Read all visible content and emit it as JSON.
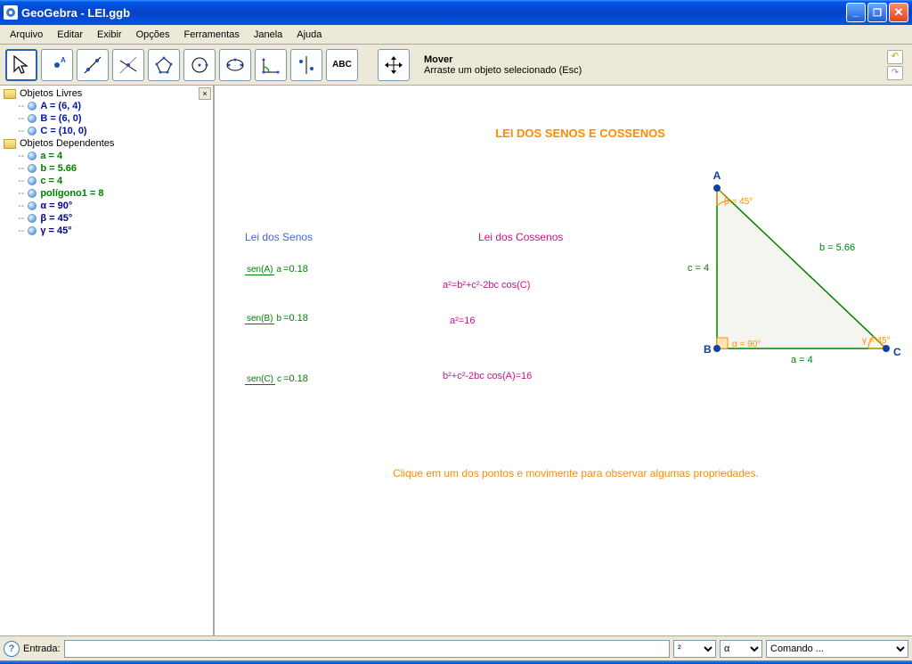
{
  "window": {
    "title": "GeoGebra - LEI.ggb"
  },
  "menu": {
    "arquivo": "Arquivo",
    "editar": "Editar",
    "exibir": "Exibir",
    "opcoes": "Opções",
    "ferramentas": "Ferramentas",
    "janela": "Janela",
    "ajuda": "Ajuda"
  },
  "toolbar": {
    "hint_title": "Mover",
    "hint_desc": "Arraste um objeto selecionado (Esc)",
    "abc": "ABC"
  },
  "tree": {
    "cat_free": "Objetos Livres",
    "cat_dep": "Objetos Dependentes",
    "A": "A = (6, 4)",
    "B": "B = (6, 0)",
    "C": "C = (10, 0)",
    "a": "a = 4",
    "b": "b = 5.66",
    "c": "c = 4",
    "poly": "polígono1 = 8",
    "alpha": "α = 90°",
    "beta": "β = 45°",
    "gamma": "γ = 45°"
  },
  "canvas": {
    "title": "LEI DOS SENOS E COSSENOS",
    "senos_head": "Lei dos Senos",
    "cossenos_head": "Lei dos Cossenos",
    "senA_num": "sen(A)",
    "senA_den": "a",
    "senA_val": "=0.18",
    "senB_num": "sen(B)",
    "senB_den": "b",
    "senB_val": "=0.18",
    "senC_num": "sen(C)",
    "senC_den": "c",
    "senC_val": "=0.18",
    "cos_formula": "a²=b²+c²-2bc cos(C)",
    "a2_val": "a²=16",
    "cos_calc": "b²+c²-2bc cos(A)=16",
    "instruction": "Clique em um dos pontos e movimente para observar algumas propriedades.",
    "tri": {
      "A": "A",
      "B": "B",
      "C": "C",
      "a_label": "a = 4",
      "b_label": "b = 5.66",
      "c_label": "c = 4",
      "alpha": "α = 90°",
      "beta": "β = 45°",
      "gamma": "γ = 45°"
    }
  },
  "bottom": {
    "entrada_label": "Entrada:",
    "sel1": "²",
    "sel2": "α",
    "sel3": "Comando ..."
  }
}
